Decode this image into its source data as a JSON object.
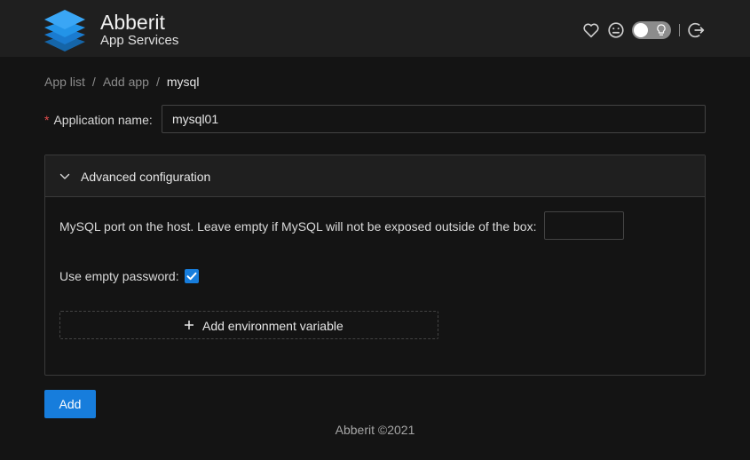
{
  "header": {
    "brand_title": "Abberit",
    "brand_subtitle": "App Services",
    "icons": [
      "logo-icon",
      "heart-icon",
      "face-icon",
      "bulb-icon",
      "logout-icon"
    ],
    "theme_toggle_on": false
  },
  "breadcrumb": {
    "items": [
      "App list",
      "Add app"
    ],
    "separator": "/",
    "current": "mysql"
  },
  "form": {
    "app_name_label": "Application name:",
    "app_name_value": "mysql01",
    "advanced": {
      "title": "Advanced configuration",
      "expanded": true,
      "port_label": "MySQL port on the host. Leave empty if MySQL will not be exposed outside of the box:",
      "port_value": "",
      "empty_password_label": "Use empty password:",
      "empty_password_checked": true,
      "add_env_label": "Add environment variable"
    },
    "submit_label": "Add"
  },
  "footer": {
    "text": "Abberit ©2021"
  },
  "colors": {
    "accent": "#177ddc",
    "header_bg": "#1f1f1f",
    "page_bg": "#141414",
    "required": "#e54e4e"
  }
}
